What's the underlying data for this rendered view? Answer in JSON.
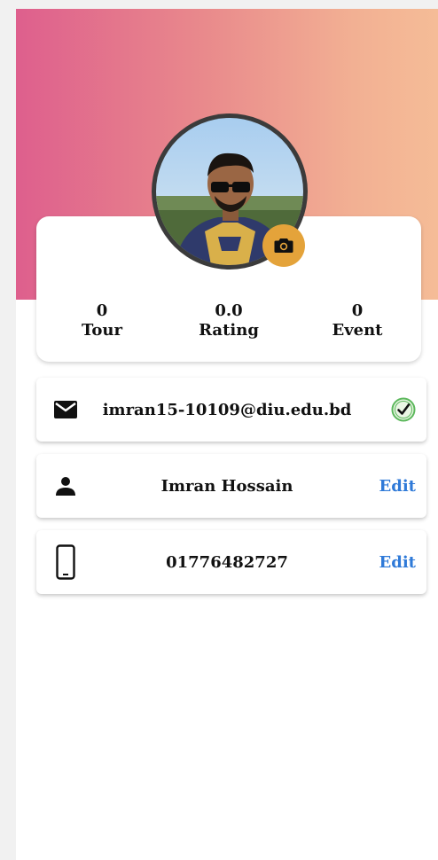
{
  "stats": {
    "tour": {
      "value": "0",
      "label": "Tour"
    },
    "rating": {
      "value": "0.0",
      "label": "Rating"
    },
    "event": {
      "value": "0",
      "label": "Event"
    }
  },
  "profile": {
    "email": "imran15-10109@diu.edu.bd",
    "email_status_icon": "verified-check-icon",
    "name": "Imran Hossain",
    "name_action": "Edit",
    "phone": "01776482727",
    "phone_action": "Edit"
  },
  "colors": {
    "gradient_start": "#de5f8d",
    "gradient_end": "#f5bc97",
    "camera_button": "#e4a33a",
    "edit_link": "#2f7ad8",
    "verified": "#5cb85c"
  },
  "icons": {
    "camera": "camera-icon",
    "email": "email-icon",
    "person": "person-icon",
    "phone": "phone-icon"
  }
}
